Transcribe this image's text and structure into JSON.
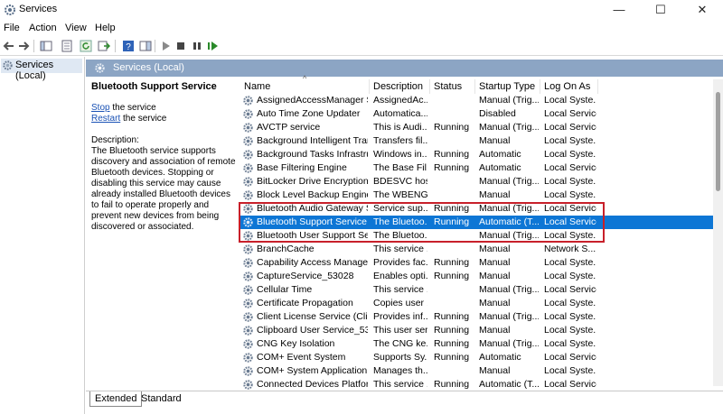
{
  "window": {
    "title": "Services",
    "min": "—",
    "max": "☐",
    "close": "✕"
  },
  "menu": [
    "File",
    "Action",
    "View",
    "Help"
  ],
  "tree": {
    "root": "Services (Local)"
  },
  "panel": {
    "header": "Services (Local)"
  },
  "details": {
    "service_name": "Bluetooth Support Service",
    "stop_link": "Stop",
    "stop_suffix": " the service",
    "restart_link": "Restart",
    "restart_suffix": " the service",
    "desc_label": "Description:",
    "desc_text": "The Bluetooth service supports discovery and association of remote Bluetooth devices.  Stopping or disabling this service may cause already installed Bluetooth devices to fail to operate properly and prevent new devices from being discovered or associated."
  },
  "columns": {
    "name": "Name",
    "description": "Description",
    "status": "Status",
    "startup": "Startup Type",
    "logon": "Log On As",
    "sort_arrow": "^"
  },
  "services": [
    [
      "AssignedAccessManager Se...",
      "AssignedAc...",
      "",
      "Manual (Trig...",
      "Local Syste..."
    ],
    [
      "Auto Time Zone Updater",
      "Automatica...",
      "",
      "Disabled",
      "Local Service"
    ],
    [
      "AVCTP service",
      "This is Audi...",
      "Running",
      "Manual (Trig...",
      "Local Service"
    ],
    [
      "Background Intelligent Tran...",
      "Transfers fil...",
      "",
      "Manual",
      "Local Syste..."
    ],
    [
      "Background Tasks Infrastruc...",
      "Windows in...",
      "Running",
      "Automatic",
      "Local Syste..."
    ],
    [
      "Base Filtering Engine",
      "The Base Fil...",
      "Running",
      "Automatic",
      "Local Service"
    ],
    [
      "BitLocker Drive Encryption ...",
      "BDESVC hos...",
      "",
      "Manual (Trig...",
      "Local Syste..."
    ],
    [
      "Block Level Backup Engine ...",
      "The WBENG...",
      "",
      "Manual",
      "Local Syste..."
    ],
    [
      "Bluetooth Audio Gateway S...",
      "Service sup...",
      "Running",
      "Manual (Trig...",
      "Local Service"
    ],
    [
      "Bluetooth Support Service",
      "The Bluetoo...",
      "Running",
      "Automatic (T...",
      "Local Service"
    ],
    [
      "Bluetooth User Support Ser...",
      "The Bluetoo...",
      "",
      "Manual (Trig...",
      "Local Syste..."
    ],
    [
      "BranchCache",
      "This service ...",
      "",
      "Manual",
      "Network S..."
    ],
    [
      "Capability Access Manager ...",
      "Provides fac...",
      "Running",
      "Manual",
      "Local Syste..."
    ],
    [
      "CaptureService_53028",
      "Enables opti...",
      "Running",
      "Manual",
      "Local Syste..."
    ],
    [
      "Cellular Time",
      "This service ...",
      "",
      "Manual (Trig...",
      "Local Service"
    ],
    [
      "Certificate Propagation",
      "Copies user ...",
      "",
      "Manual",
      "Local Syste..."
    ],
    [
      "Client License Service (ClipS...",
      "Provides inf...",
      "Running",
      "Manual (Trig...",
      "Local Syste..."
    ],
    [
      "Clipboard User Service_53028",
      "This user ser...",
      "Running",
      "Manual",
      "Local Syste..."
    ],
    [
      "CNG Key Isolation",
      "The CNG ke...",
      "Running",
      "Manual (Trig...",
      "Local Syste..."
    ],
    [
      "COM+ Event System",
      "Supports Sy...",
      "Running",
      "Automatic",
      "Local Service"
    ],
    [
      "COM+ System Application",
      "Manages th...",
      "",
      "Manual",
      "Local Syste..."
    ],
    [
      "Connected Devices Platfor...",
      "This service ...",
      "Running",
      "Automatic (T...",
      "Local Service"
    ]
  ],
  "selected_index": 9,
  "tabs": {
    "extended": "Extended",
    "standard": "Standard"
  },
  "colors": {
    "selection": "#0d76d5",
    "highlight_box": "#c8202a",
    "panel_header": "#8ca5c4"
  }
}
